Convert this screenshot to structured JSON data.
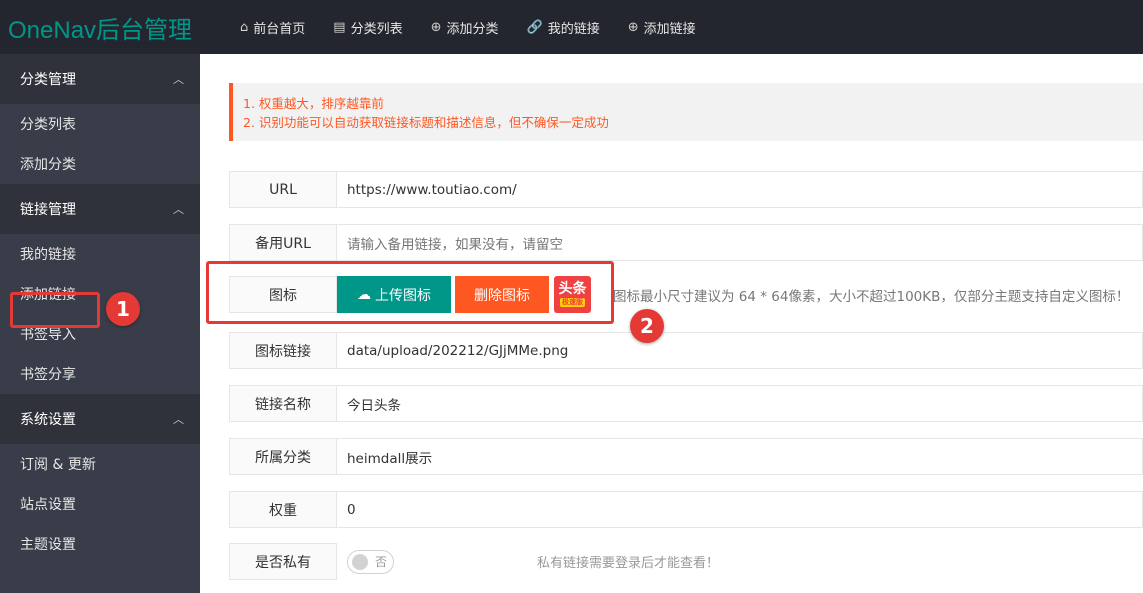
{
  "header": {
    "logo": "OneNav后台管理",
    "nav": [
      {
        "icon": "home-icon",
        "glyph": "⌂",
        "label": "前台首页"
      },
      {
        "icon": "list-icon",
        "glyph": "▤",
        "label": "分类列表"
      },
      {
        "icon": "plus-circle-icon",
        "glyph": "⊕",
        "label": "添加分类"
      },
      {
        "icon": "link-icon",
        "glyph": "🔗",
        "label": "我的链接"
      },
      {
        "icon": "plus-circle-icon",
        "glyph": "⊕",
        "label": "添加链接"
      }
    ]
  },
  "sidebar": {
    "groups": [
      {
        "title": "分类管理",
        "items": [
          "分类列表",
          "添加分类"
        ]
      },
      {
        "title": "链接管理",
        "items": [
          "我的链接",
          "添加链接",
          "书签导入",
          "书签分享"
        ]
      },
      {
        "title": "系统设置",
        "items": [
          "订阅 & 更新",
          "站点设置",
          "主题设置"
        ]
      }
    ]
  },
  "annotations": {
    "badge1": "1",
    "badge2": "2"
  },
  "tips": [
    "1. 权重越大，排序越靠前",
    "2. 识别功能可以自动获取链接标题和描述信息，但不确保一定成功"
  ],
  "form": {
    "url": {
      "label": "URL",
      "value": "https://www.toutiao.com/"
    },
    "backup_url": {
      "label": "备用URL",
      "placeholder": "请输入备用链接，如果没有，请留空"
    },
    "icon": {
      "label": "图标",
      "upload_label": "上传图标",
      "delete_label": "删除图标",
      "preview_text": "头条",
      "preview_subtext": "极速版",
      "hint": "图标最小尺寸建议为 64 * 64像素，大小不超过100KB，仅部分主题支持自定义图标！"
    },
    "icon_link": {
      "label": "图标链接",
      "value": "data/upload/202212/GJjMMe.png"
    },
    "link_name": {
      "label": "链接名称",
      "value": "今日头条"
    },
    "category": {
      "label": "所属分类",
      "value": "heimdall展示"
    },
    "weight": {
      "label": "权重",
      "value": "0"
    },
    "private": {
      "label": "是否私有",
      "switch_text": "否",
      "hint": "私有链接需要登录后才能查看！"
    }
  },
  "colors": {
    "accent": "#009688",
    "danger": "#ff5722",
    "annotation": "#e53935",
    "sidebar": "#393d49",
    "header": "#23262e"
  }
}
